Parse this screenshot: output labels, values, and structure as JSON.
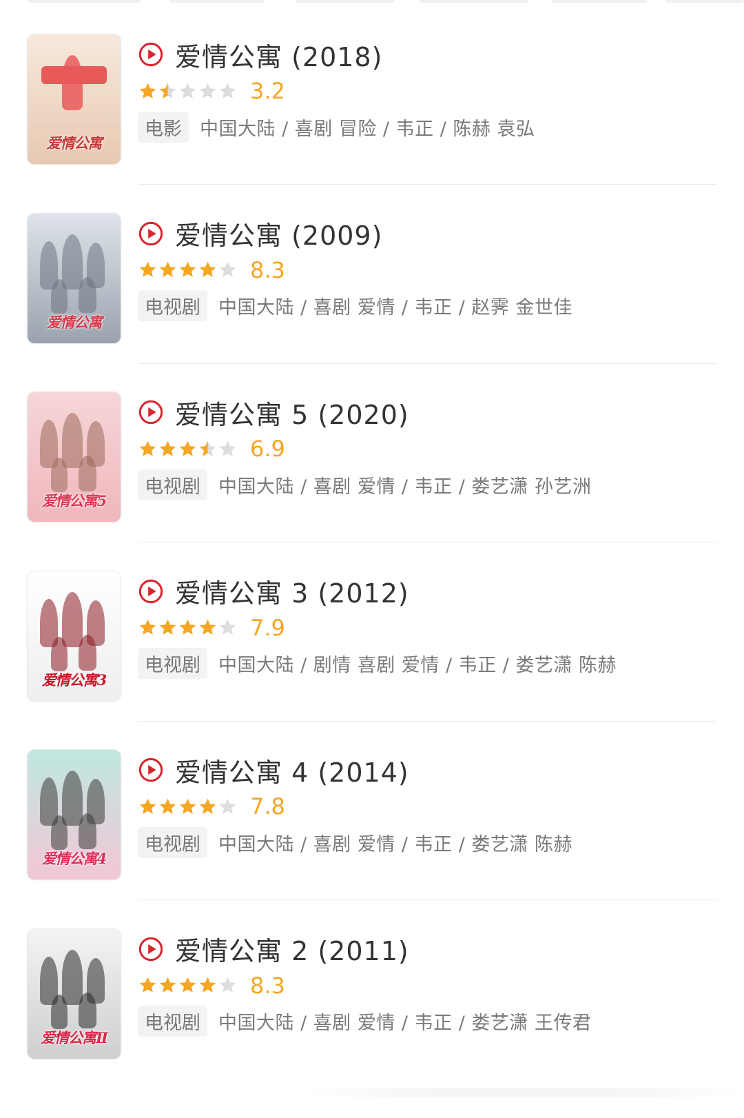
{
  "colors": {
    "accent_red": "#d9252c",
    "star_orange": "#f5a623",
    "star_empty": "#dddddd"
  },
  "items": [
    {
      "title": "爱情公寓 (2018)",
      "score": "3.2",
      "stars": 1.5,
      "type": "电影",
      "meta": "中国大陆 / 喜剧 冒险 / 韦正 / 陈赫 袁弘",
      "poster_title": "爱情公寓",
      "poster_bg": [
        "#f7e9dc",
        "#e8c9b2"
      ],
      "poster_accent": "#e85a5a",
      "poster_title_color": "#c63a3a"
    },
    {
      "title": "爱情公寓 (2009)",
      "score": "8.3",
      "stars": 4,
      "type": "电视剧",
      "meta": "中国大陆 / 喜剧 爱情 / 韦正 / 赵霁 金世佳",
      "poster_title": "爱情公寓",
      "poster_bg": [
        "#dfe4ea",
        "#9aa3ad"
      ],
      "poster_accent": "#6b7580",
      "poster_title_color": "#d63a4c"
    },
    {
      "title": "爱情公寓 5 (2020)",
      "score": "6.9",
      "stars": 3.5,
      "type": "电视剧",
      "meta": "中国大陆 / 喜剧 爱情 / 韦正 / 娄艺潇 孙艺洲",
      "poster_title": "爱情公寓5",
      "poster_bg": [
        "#f6d6d8",
        "#efb7bd"
      ],
      "poster_accent": "#9a6a5a",
      "poster_title_color": "#d83a55"
    },
    {
      "title": "爱情公寓 3 (2012)",
      "score": "7.9",
      "stars": 4,
      "type": "电视剧",
      "meta": "中国大陆 / 剧情 喜剧 爱情 / 韦正 / 娄艺潇 陈赫",
      "poster_title": "爱情公寓3",
      "poster_bg": [
        "#ffffff",
        "#eeeeee"
      ],
      "poster_accent": "#8b1a22",
      "poster_title_color": "#c8182c"
    },
    {
      "title": "爱情公寓 4 (2014)",
      "score": "7.8",
      "stars": 4,
      "type": "电视剧",
      "meta": "中国大陆 / 喜剧 爱情 / 韦正 / 娄艺潇 陈赫",
      "poster_title": "爱情公寓4",
      "poster_bg": [
        "#bfe8e0",
        "#f3c6d6"
      ],
      "poster_accent": "#3a3a3a",
      "poster_title_color": "#d8325a"
    },
    {
      "title": "爱情公寓 2 (2011)",
      "score": "8.3",
      "stars": 4,
      "type": "电视剧",
      "meta": "中国大陆 / 喜剧 爱情 / 韦正 / 娄艺潇 王传君",
      "poster_title": "爱情公寓Ⅱ",
      "poster_bg": [
        "#f3f3f3",
        "#cfcfcf"
      ],
      "poster_accent": "#2a2a2a",
      "poster_title_color": "#d8284a"
    }
  ]
}
